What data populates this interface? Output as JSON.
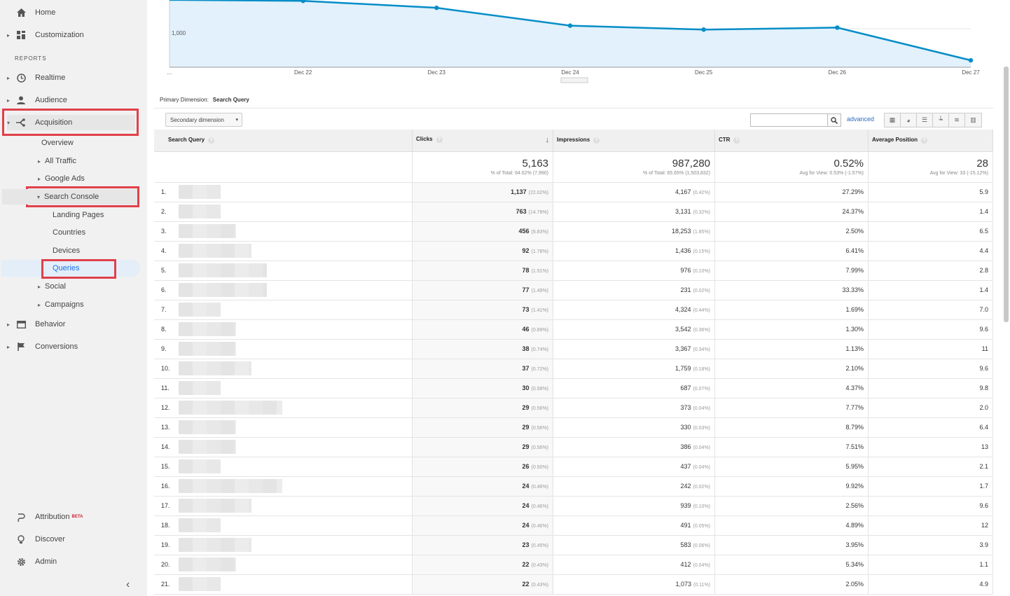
{
  "nav": {
    "home": "Home",
    "customization": "Customization",
    "reports": "REPORTS",
    "realtime": "Realtime",
    "audience": "Audience",
    "acquisition": "Acquisition",
    "overview": "Overview",
    "all_traffic": "All Traffic",
    "google_ads": "Google Ads",
    "search_console": "Search Console",
    "landing_pages": "Landing Pages",
    "countries": "Countries",
    "devices": "Devices",
    "queries": "Queries",
    "social": "Social",
    "campaigns": "Campaigns",
    "behavior": "Behavior",
    "conversions": "Conversions",
    "attribution": "Attribution",
    "beta": "BETA",
    "discover": "Discover",
    "admin": "Admin"
  },
  "chart_data": {
    "type": "area",
    "x": [
      "...",
      "Dec 22",
      "Dec 23",
      "Dec 24",
      "Dec 25",
      "Dec 26",
      "Dec 27"
    ],
    "values": [
      1240,
      1235,
      1200,
      1110,
      1090,
      1100,
      935
    ],
    "y_tick_label": "1,000",
    "color": "#058dc7"
  },
  "primary_dimension": {
    "label": "Primary Dimension:",
    "value": "Search Query"
  },
  "toolbar": {
    "secondary_dimension": "Secondary dimension",
    "advanced": "advanced"
  },
  "columns": {
    "query": "Search Query",
    "clicks": "Clicks",
    "impressions": "Impressions",
    "ctr": "CTR",
    "position": "Average Position"
  },
  "totals": {
    "clicks": "5,163",
    "clicks_sub": "% of Total: 64.62% (7,990)",
    "impressions": "987,280",
    "impressions_sub": "% of Total: 65.65% (1,503,832)",
    "ctr": "0.52%",
    "ctr_sub": "Avg for View: 0.53% (-1.57%)",
    "position": "28",
    "position_sub": "Avg for View: 33 (-15.12%)"
  },
  "rows": [
    {
      "n": "1.",
      "clicks": "1,137",
      "cp": "(22.02%)",
      "impr": "4,167",
      "ip": "(0.42%)",
      "ctr": "27.29%",
      "pos": "5.9"
    },
    {
      "n": "2.",
      "clicks": "763",
      "cp": "(14.78%)",
      "impr": "3,131",
      "ip": "(0.32%)",
      "ctr": "24.37%",
      "pos": "1.4"
    },
    {
      "n": "3.",
      "clicks": "456",
      "cp": "(8.83%)",
      "impr": "18,253",
      "ip": "(1.85%)",
      "ctr": "2.50%",
      "pos": "6.5"
    },
    {
      "n": "4.",
      "clicks": "92",
      "cp": "(1.78%)",
      "impr": "1,436",
      "ip": "(0.15%)",
      "ctr": "6.41%",
      "pos": "4.4"
    },
    {
      "n": "5.",
      "clicks": "78",
      "cp": "(1.51%)",
      "impr": "976",
      "ip": "(0.10%)",
      "ctr": "7.99%",
      "pos": "2.8"
    },
    {
      "n": "6.",
      "clicks": "77",
      "cp": "(1.49%)",
      "impr": "231",
      "ip": "(0.02%)",
      "ctr": "33.33%",
      "pos": "1.4"
    },
    {
      "n": "7.",
      "clicks": "73",
      "cp": "(1.41%)",
      "impr": "4,324",
      "ip": "(0.44%)",
      "ctr": "1.69%",
      "pos": "7.0"
    },
    {
      "n": "8.",
      "clicks": "46",
      "cp": "(0.89%)",
      "impr": "3,542",
      "ip": "(0.36%)",
      "ctr": "1.30%",
      "pos": "9.6"
    },
    {
      "n": "9.",
      "clicks": "38",
      "cp": "(0.74%)",
      "impr": "3,367",
      "ip": "(0.34%)",
      "ctr": "1.13%",
      "pos": "11"
    },
    {
      "n": "10.",
      "clicks": "37",
      "cp": "(0.72%)",
      "impr": "1,759",
      "ip": "(0.18%)",
      "ctr": "2.10%",
      "pos": "9.6"
    },
    {
      "n": "11.",
      "clicks": "30",
      "cp": "(0.58%)",
      "impr": "687",
      "ip": "(0.07%)",
      "ctr": "4.37%",
      "pos": "9.8"
    },
    {
      "n": "12.",
      "clicks": "29",
      "cp": "(0.56%)",
      "impr": "373",
      "ip": "(0.04%)",
      "ctr": "7.77%",
      "pos": "2.0"
    },
    {
      "n": "13.",
      "clicks": "29",
      "cp": "(0.56%)",
      "impr": "330",
      "ip": "(0.03%)",
      "ctr": "8.79%",
      "pos": "6.4"
    },
    {
      "n": "14.",
      "clicks": "29",
      "cp": "(0.56%)",
      "impr": "386",
      "ip": "(0.04%)",
      "ctr": "7.51%",
      "pos": "13"
    },
    {
      "n": "15.",
      "clicks": "26",
      "cp": "(0.50%)",
      "impr": "437",
      "ip": "(0.04%)",
      "ctr": "5.95%",
      "pos": "2.1"
    },
    {
      "n": "16.",
      "clicks": "24",
      "cp": "(0.46%)",
      "impr": "242",
      "ip": "(0.02%)",
      "ctr": "9.92%",
      "pos": "1.7"
    },
    {
      "n": "17.",
      "clicks": "24",
      "cp": "(0.46%)",
      "impr": "939",
      "ip": "(0.10%)",
      "ctr": "2.56%",
      "pos": "9.6"
    },
    {
      "n": "18.",
      "clicks": "24",
      "cp": "(0.46%)",
      "impr": "491",
      "ip": "(0.05%)",
      "ctr": "4.89%",
      "pos": "12"
    },
    {
      "n": "19.",
      "clicks": "23",
      "cp": "(0.45%)",
      "impr": "583",
      "ip": "(0.06%)",
      "ctr": "3.95%",
      "pos": "3.9"
    },
    {
      "n": "20.",
      "clicks": "22",
      "cp": "(0.43%)",
      "impr": "412",
      "ip": "(0.04%)",
      "ctr": "5.34%",
      "pos": "1.1"
    },
    {
      "n": "21.",
      "clicks": "22",
      "cp": "(0.43%)",
      "impr": "1,073",
      "ip": "(0.11%)",
      "ctr": "2.05%",
      "pos": "4.9"
    }
  ]
}
